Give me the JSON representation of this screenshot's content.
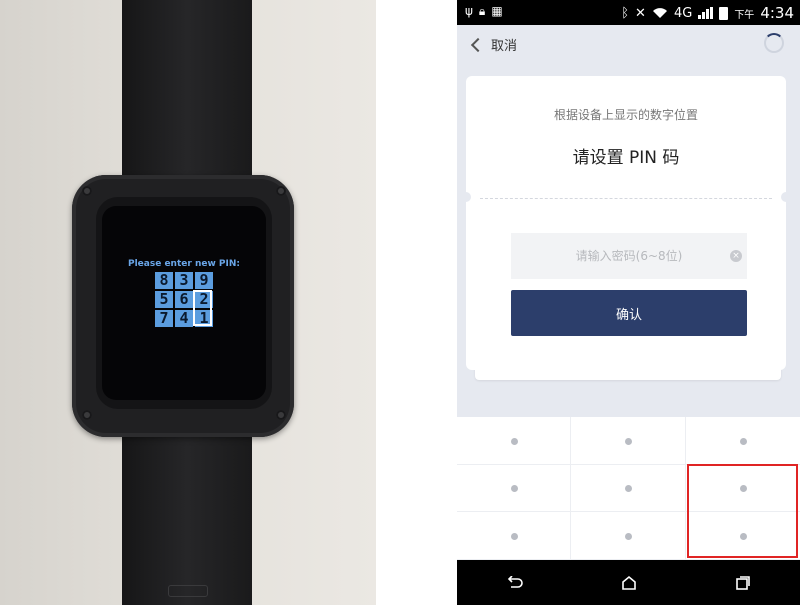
{
  "watch": {
    "prompt": "Please enter new PIN:",
    "pin_grid": [
      [
        "8",
        "3",
        "9"
      ],
      [
        "5",
        "6",
        "2"
      ],
      [
        "7",
        "4",
        "1"
      ]
    ],
    "colors": {
      "grid": "#5b9ddf",
      "screen": "#050507"
    }
  },
  "phone": {
    "status_bar": {
      "icons_left": [
        "usb-icon",
        "lock-icon",
        "image-icon"
      ],
      "network": "4G",
      "ampm": "下午",
      "time": "4:34"
    },
    "nav": {
      "back_label": "取消"
    },
    "card": {
      "subtitle": "根据设备上显示的数字位置",
      "title": "请设置 PIN 码",
      "password_placeholder": "请输入密码(6~8位)",
      "password_value": "",
      "confirm_label": "确认"
    },
    "keypad": {
      "rows": 3,
      "cols": 3,
      "highlighted_keys": [
        6,
        9
      ]
    },
    "system_nav": [
      "back-icon",
      "home-icon",
      "recents-icon"
    ],
    "colors": {
      "accent": "#2c3e6b",
      "background": "#e6e9f0",
      "highlight": "#e02424"
    }
  }
}
